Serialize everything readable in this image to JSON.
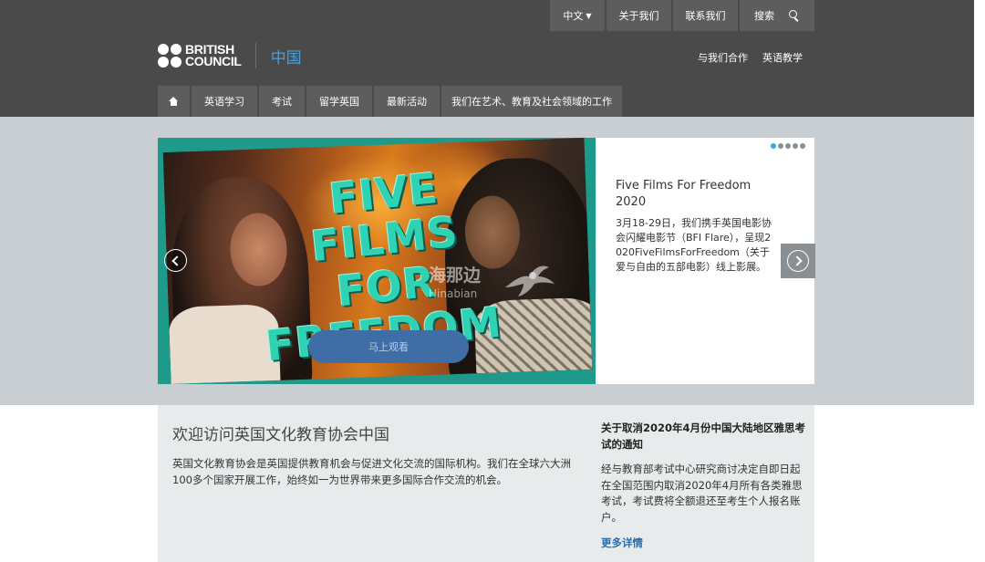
{
  "topbar": {
    "language": "中文",
    "about": "关于我们",
    "contact": "联系我们",
    "search": "搜索",
    "search_icon": "search-icon"
  },
  "brand": {
    "logo_line1": "BRITISH",
    "logo_line2": "COUNCIL",
    "country": "中国"
  },
  "header_links": {
    "partner": "与我们合作",
    "teaching": "英语教学"
  },
  "nav": {
    "home_icon": "home-icon",
    "items": [
      "英语学习",
      "考试",
      "留学英国",
      "最新活动",
      "我们在艺术、教育及社会领域的工作"
    ]
  },
  "hero": {
    "image_text": [
      "FIVE",
      "FILMS",
      "FOR",
      "FREEDOM"
    ],
    "watermark": "海那边",
    "watermark_sub": "Hinabian",
    "watch_button": "马上观看",
    "title": "Five Films For Freedom 2020",
    "description": "3月18-29日，我们携手英国电影协会闪耀电影节（BFI Flare），呈现2020FiveFilmsForFreedom（关于爱与自由的五部电影）线上影展。",
    "slide_count": 5,
    "active_slide": 1
  },
  "content": {
    "welcome_title": "欢迎访问英国文化教育协会中国",
    "welcome_text": "英国文化教育协会是英国提供教育机会与促进文化交流的国际机构。我们在全球六大洲100多个国家开展工作，始终如一为世界带来更多国际合作交流的机会。",
    "news_title": "关于取消2020年4月份中国大陆地区雅思考试的通知",
    "news_text": "经与教育部考试中心研究商讨决定自即日起在全国范围内取消2020年4月所有各类雅思考试，考试费将全额退还至考生个人报名账户。",
    "more_link": "更多详情"
  },
  "colors": {
    "header_bg": "#4a4a4a",
    "button_bg": "#5d5d5d",
    "accent_blue": "#27b0e6",
    "hero_band": "#c8ced1",
    "content_bg": "#e7ebec",
    "link": "#2f6cab"
  }
}
